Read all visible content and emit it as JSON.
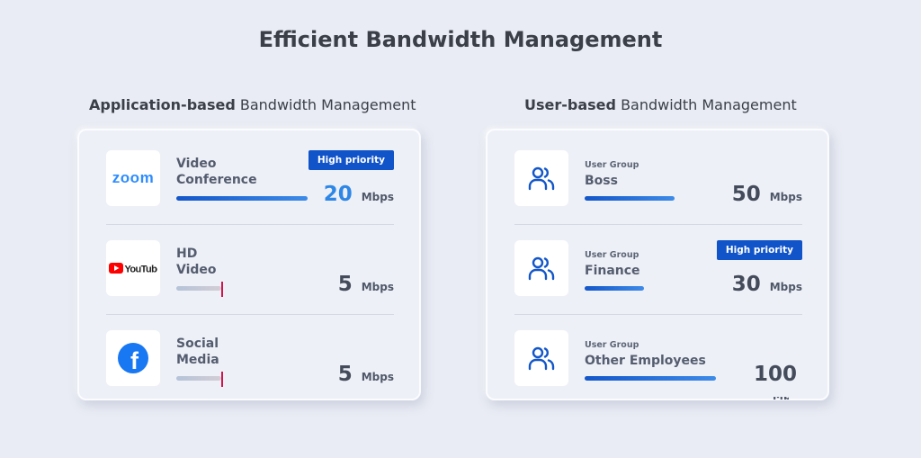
{
  "page": {
    "title": "Efficient Bandwidth Management"
  },
  "sections": {
    "app": {
      "heading_bold": "Application-based",
      "heading_rest": " Bandwidth Management"
    },
    "user": {
      "heading_bold": "User-based",
      "heading_rest": " Bandwidth Management"
    }
  },
  "badge_label": "High priority",
  "unit": "Mbps",
  "app_rows": [
    {
      "logo": "zoom-logo",
      "logo_text": "zoom",
      "line1": "Video",
      "line2": "Conference",
      "rate": "20",
      "bar_fraction": 1.0,
      "priority": true
    },
    {
      "logo": "youtube-logo",
      "logo_text": "YouTube",
      "line1": "HD",
      "line2": "Video",
      "rate": "5",
      "bar_fraction": 0.25,
      "priority": false
    },
    {
      "logo": "facebook-logo",
      "logo_text": "f",
      "line1": "Social",
      "line2": "Media",
      "rate": "5",
      "bar_fraction": 0.25,
      "priority": false
    }
  ],
  "user_rows": [
    {
      "caption": "User Group",
      "name": "Boss",
      "rate": "50",
      "bar_fraction": 0.5,
      "priority": false
    },
    {
      "caption": "User Group",
      "name": "Finance",
      "rate": "30",
      "bar_fraction": 0.3,
      "priority": true
    },
    {
      "caption": "User Group",
      "name": "Other Employees",
      "rate": "100",
      "bar_fraction": 1.0,
      "priority": false,
      "unit_clipped": true
    }
  ],
  "colors": {
    "background": "#e9ecf4",
    "accent": "#1153c8",
    "accent_light": "#2e87e6",
    "marker": "#d0144b",
    "zoom_blue": "#2d8cff",
    "youtube_red": "#ff0000",
    "facebook_blue": "#1877f2",
    "user_icon_blue": "#1356c9"
  }
}
